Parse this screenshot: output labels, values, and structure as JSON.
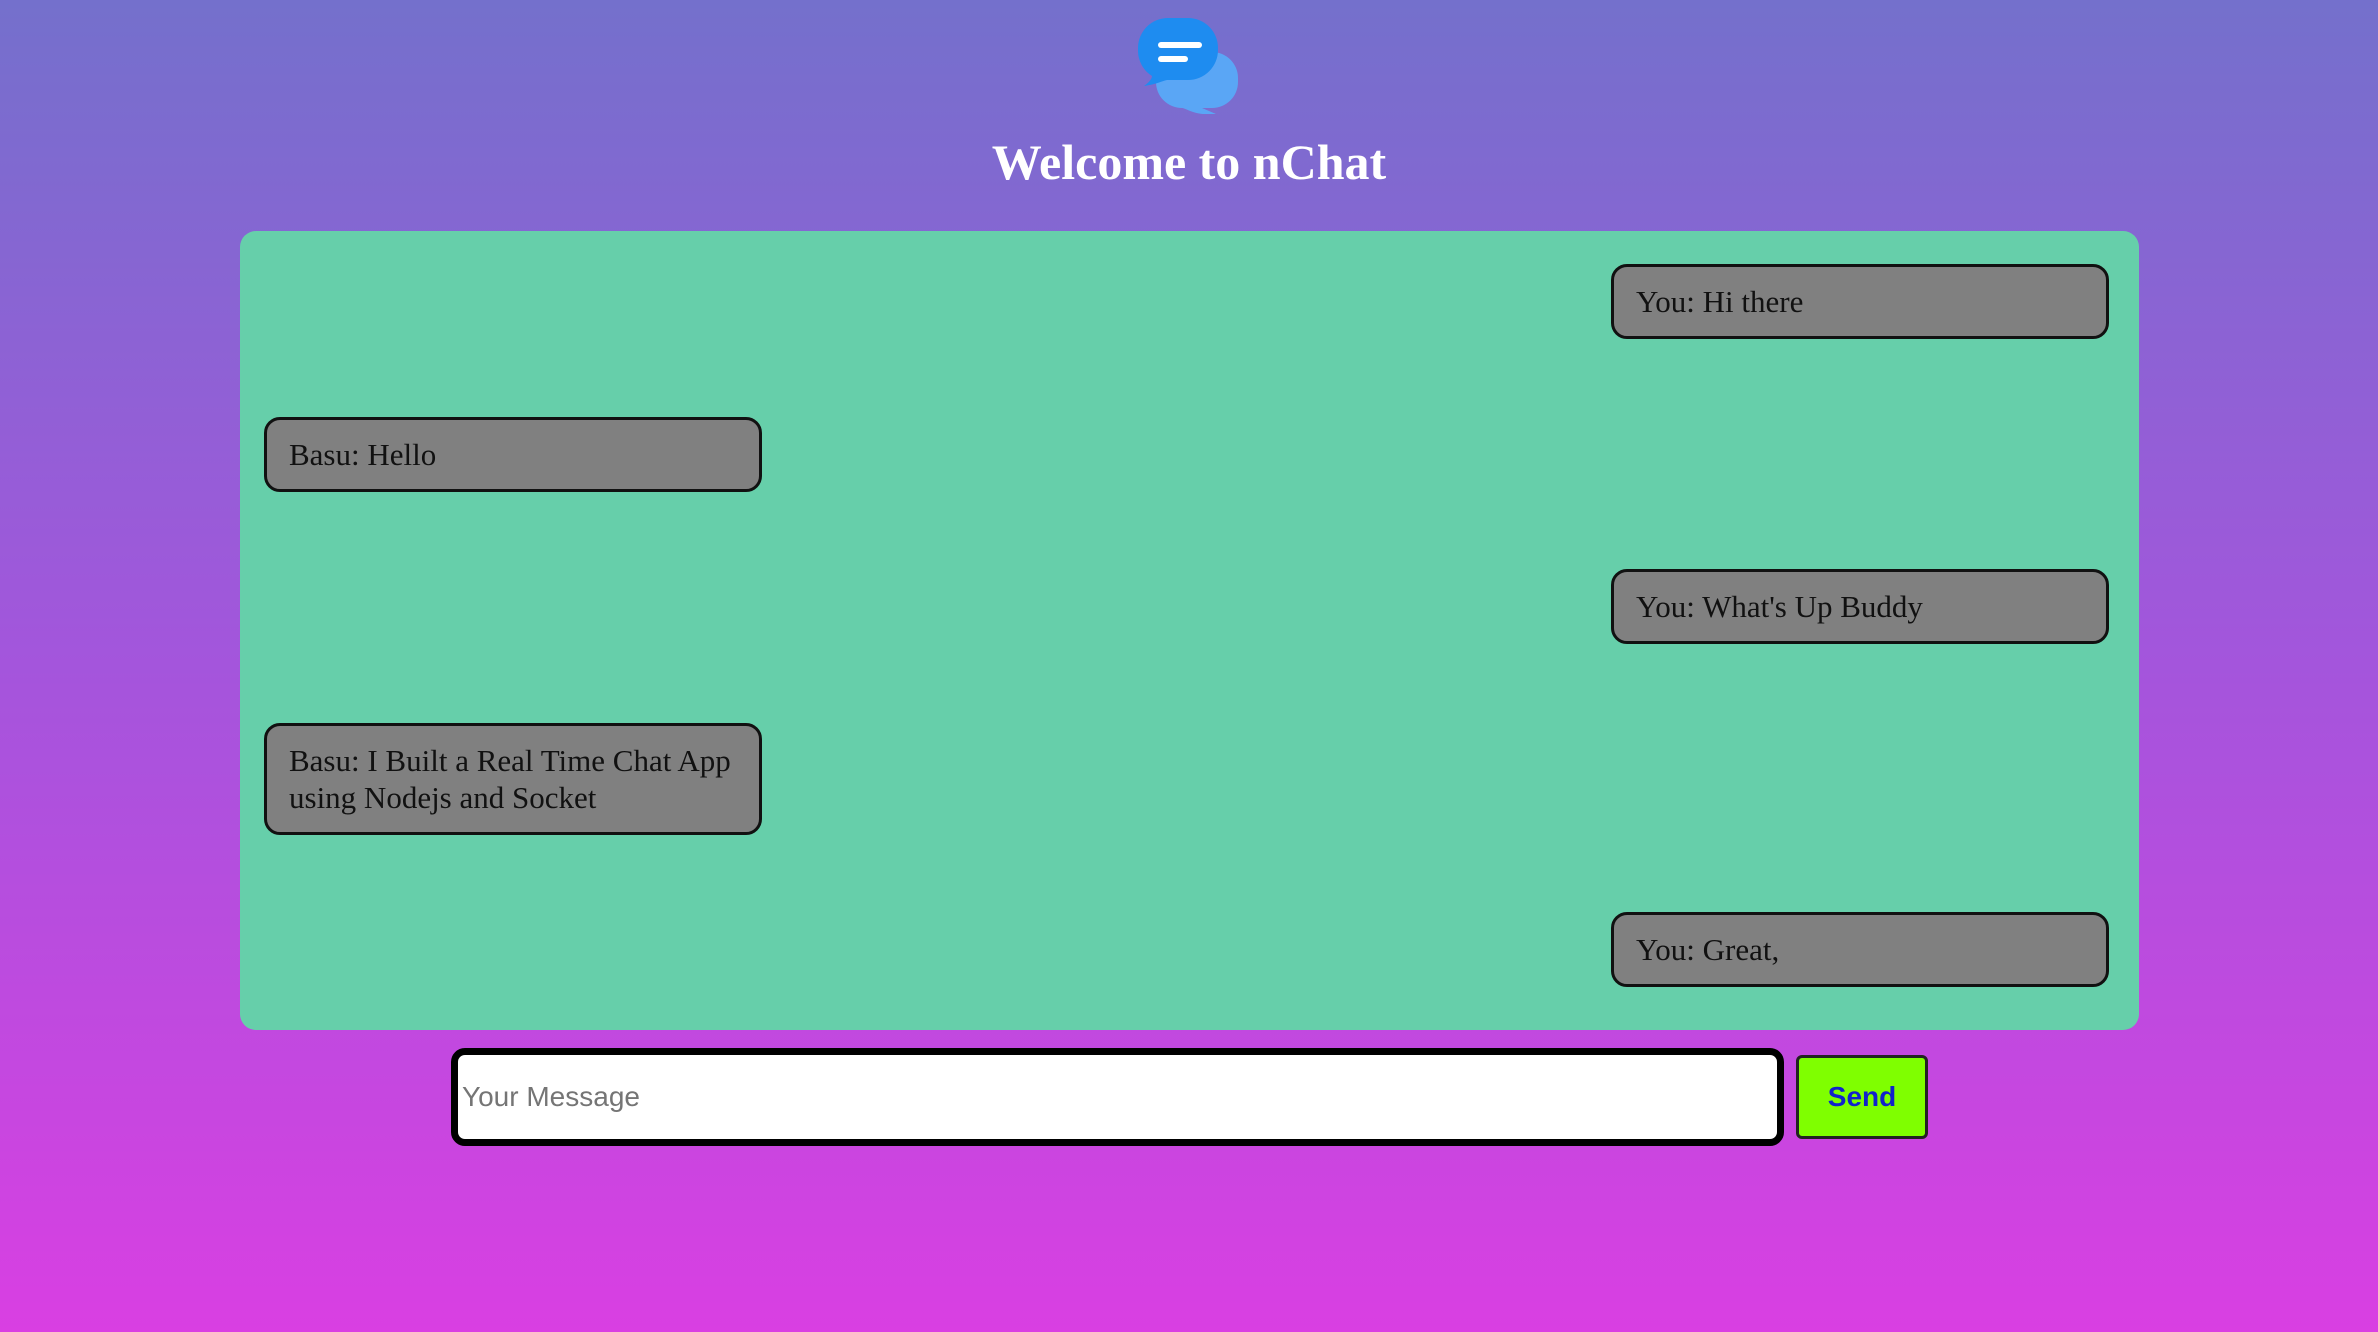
{
  "header": {
    "logo_icon": "chat-bubbles-icon",
    "title": "Welcome to nChat"
  },
  "messages": [
    {
      "side": "right",
      "text": "You: Hi there"
    },
    {
      "side": "left",
      "text": "Basu: Hello"
    },
    {
      "side": "right",
      "text": "You: What's Up Buddy"
    },
    {
      "side": "left",
      "text": "Basu: I Built a Real Time Chat App using Nodejs and Socket"
    },
    {
      "side": "right",
      "text": "You: Great,"
    }
  ],
  "composer": {
    "placeholder": "Your Message",
    "value": "",
    "send_label": "Send"
  },
  "colors": {
    "background_top": "#7470cc",
    "background_bottom": "#d93fe2",
    "chat_area": "#66cfaa",
    "bubble": "#808080",
    "send_button": "#7fff00",
    "send_text": "#1122cc"
  }
}
